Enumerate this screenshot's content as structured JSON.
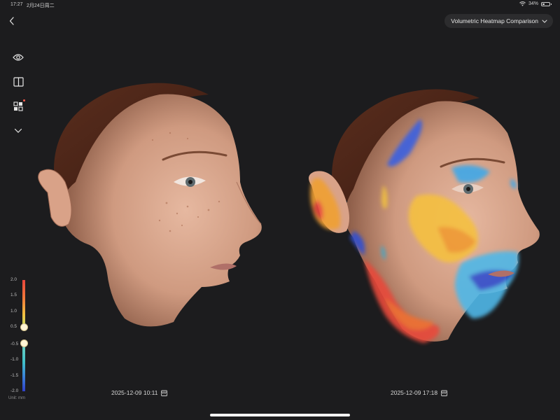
{
  "status_bar": {
    "time": "17:27",
    "date": "2月24日周二",
    "battery": "34%",
    "battery_level": 0.34
  },
  "header": {
    "mode_label": "Volumetric Heatmap Comparison"
  },
  "toolbar": {
    "icons": [
      "eye-icon",
      "split-view-icon",
      "grid-icon",
      "chevron-down-icon"
    ]
  },
  "scale": {
    "ticks": [
      "2.0",
      "1.5",
      "1.0",
      "0.5",
      "-0.5",
      "-1.0",
      "-1.5",
      "-2.0"
    ],
    "unit": "Unit: mm",
    "upper_threshold": 0.5,
    "lower_threshold": -0.5,
    "colors": {
      "max": "#e8453c",
      "mid_high": "#f0c040",
      "low": "#40c0c8",
      "min": "#3040c8"
    }
  },
  "views": [
    {
      "date": "2025-12-09 10:11"
    },
    {
      "date": "2025-12-09 17:18"
    }
  ]
}
